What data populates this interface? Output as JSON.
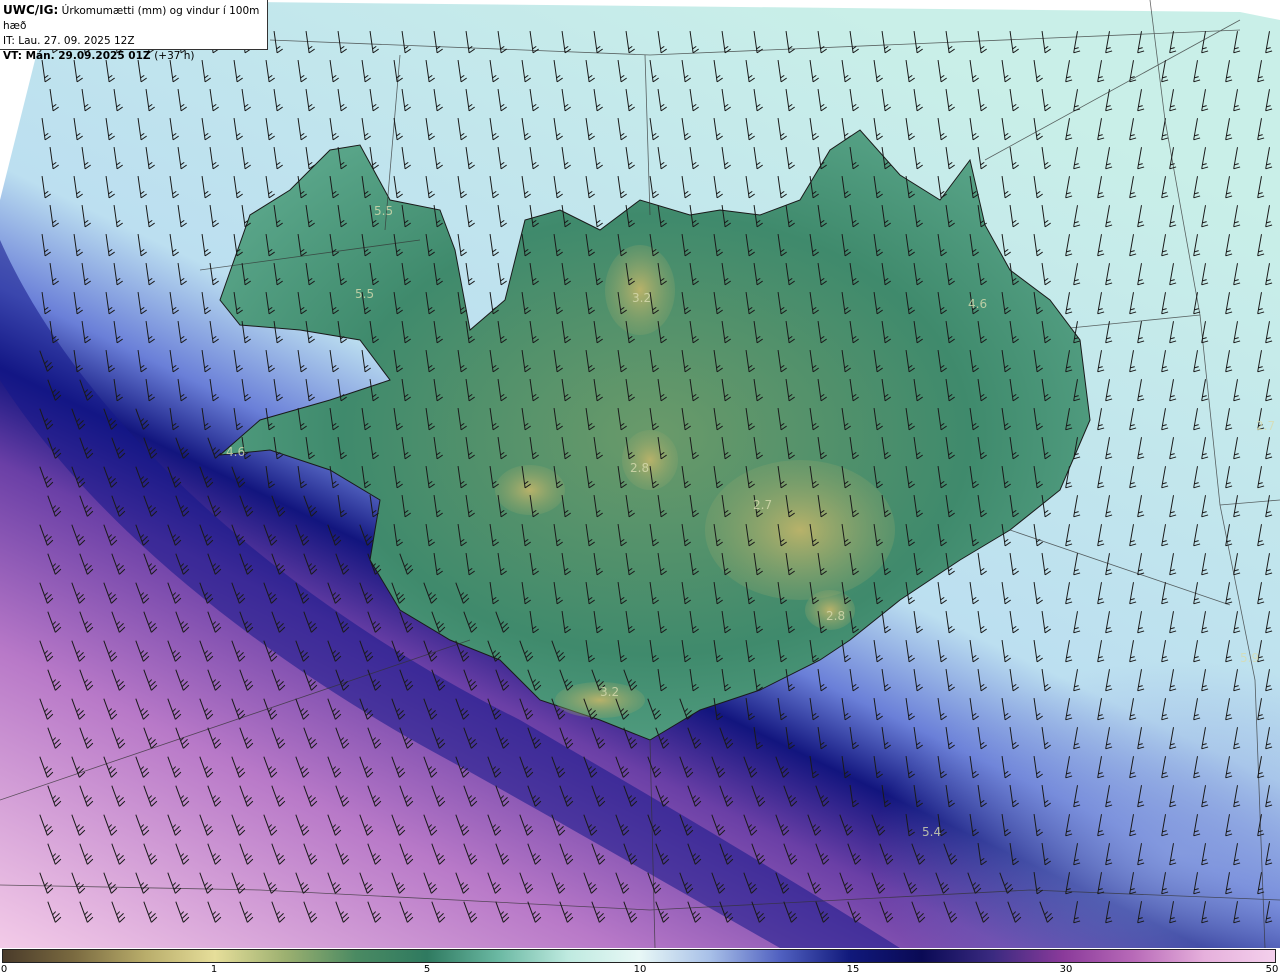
{
  "header": {
    "code": "UWC/IG:",
    "title": "Úrkomumætti (mm) og vindur í 100m hæð",
    "issue_time": "IT: Lau. 27. 09. 2025 12Z",
    "valid_time": "VT: Mán. 29.09.2025 01Z",
    "lead": "(+37 h)"
  },
  "value_labels": [
    "5.5",
    "5.5",
    "3.2",
    "4.6",
    "2.7",
    "4.6",
    "2.8",
    "2.7",
    "2.8",
    "3.2",
    "5.9",
    "5.4"
  ],
  "colorbar": {
    "ticks": [
      "0",
      "1",
      "5",
      "10",
      "15",
      "30",
      "50"
    ],
    "colors": [
      "#4a3b2a",
      "#7a6a40",
      "#b8ac6a",
      "#e6de9a",
      "#9cb070",
      "#4a8a62",
      "#2f7a60",
      "#6ab8a2",
      "#bfeae0",
      "#e8f8f6",
      "#a8c0e8",
      "#5060c0",
      "#10187a",
      "#0a0a55",
      "#3a2a80",
      "#8a3a9a",
      "#b86ab8",
      "#e6b0dc",
      "#f4d0ec"
    ]
  },
  "colors": {
    "ocean_far": "#f2c6e6",
    "ocean_mid": "#9a58b8",
    "front": "#12157e",
    "sea_light": "#c7ecea",
    "land_low": "#3e8c6c",
    "land_high": "#b7b46a"
  }
}
